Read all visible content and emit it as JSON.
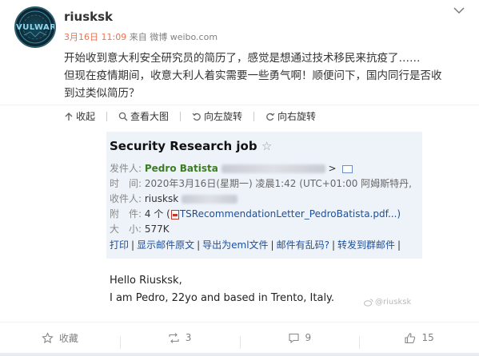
{
  "post": {
    "avatar_text": "VULWAR",
    "username": "riusksk",
    "time": "3月16日 11:09",
    "source_prefix": "来自",
    "source_app": "微博 weibo.com",
    "text_line1": "开始收到意大利安全研究员的简历了，感觉是想通过技术移民来抗疫了……",
    "text_line2": "但现在疫情期间，收意大利人着实需要一些勇气啊！顺便问下，国内同行是否收",
    "text_line3": "到过类似简历？"
  },
  "image_toolbar": {
    "collapse": "收起",
    "view_large": "查看大图",
    "rotate_left": "向左旋转",
    "rotate_right": "向右旋转"
  },
  "email": {
    "subject": "Security Research job",
    "star": "☆",
    "sender_label": "发件人:",
    "sender_name": "Pedro Batista",
    "sender_tail": ">",
    "time_label": "时　间:",
    "time_value": "2020年3月16日(星期一) 凌晨1:42 (UTC+01:00 阿姆斯特丹,",
    "recipient_label": "收件人:",
    "recipient_value": "riusksk",
    "attachment_label": "附　件:",
    "attachment_count": "4 个 (",
    "attachment_name": "TSRecommendationLetter_PedroBatista.pdf...)",
    "size_label": "大　小:",
    "size_value": "577K",
    "actions": [
      "打印",
      "显示邮件原文",
      "导出为eml文件",
      "邮件有乱码?",
      "转发到群邮件"
    ],
    "body_line1": "Hello Riusksk,",
    "body_line2": "I am Pedro, 22yo and based in Trento, Italy.",
    "watermark": "@riusksk"
  },
  "action_bar": {
    "favorite": "收藏",
    "repost_count": "3",
    "comment_count": "9",
    "like_count": "15"
  },
  "colors": {
    "time_accent": "#eb7350",
    "sender_green": "#3c7d23",
    "link_blue": "#1b4f9c",
    "email_header_bg": "#eef3fa"
  }
}
